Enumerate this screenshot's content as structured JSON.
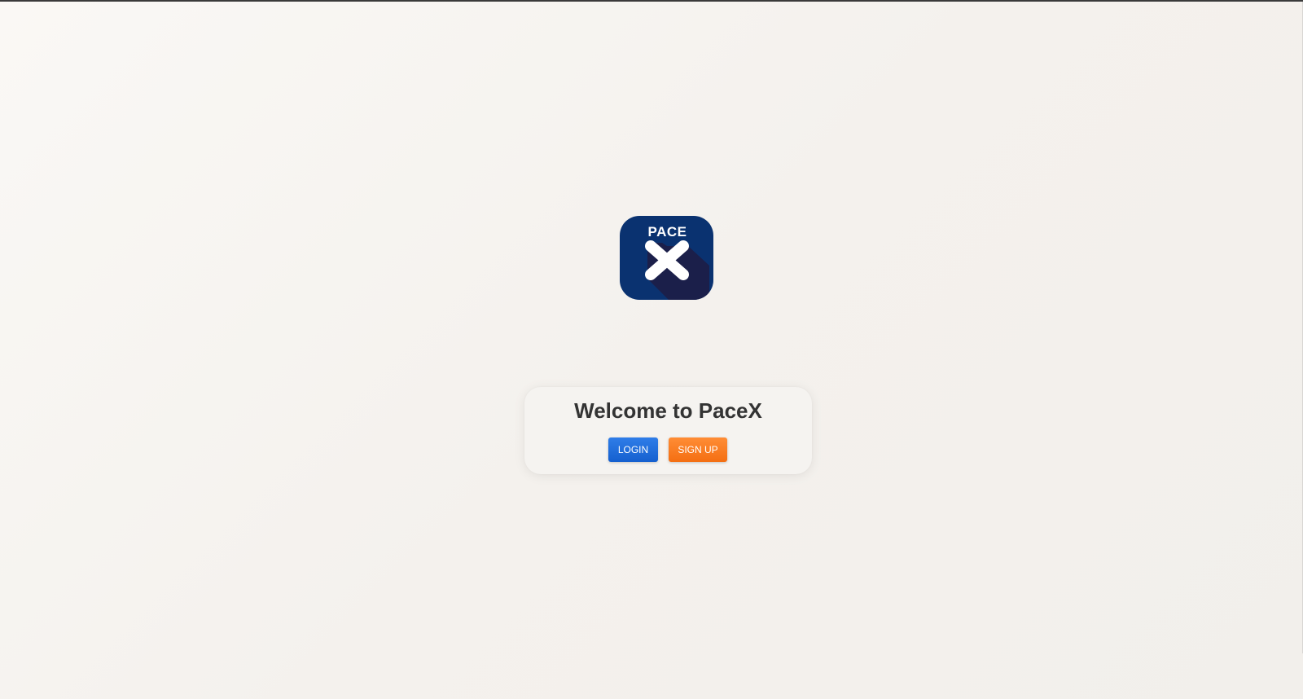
{
  "logo": {
    "text": "PACE",
    "mark": "X",
    "icon": "pacex-logo-icon",
    "colors": {
      "background": "#0a3270",
      "shadow": "#1b1f4a",
      "mark": "#ffffff"
    }
  },
  "welcome": {
    "title": "Welcome to PaceX"
  },
  "buttons": {
    "login_label": "LOGIN",
    "signup_label": "SIGN UP"
  },
  "colors": {
    "login": "#1e6ddc",
    "signup": "#f7801f",
    "title_text": "#333333"
  }
}
